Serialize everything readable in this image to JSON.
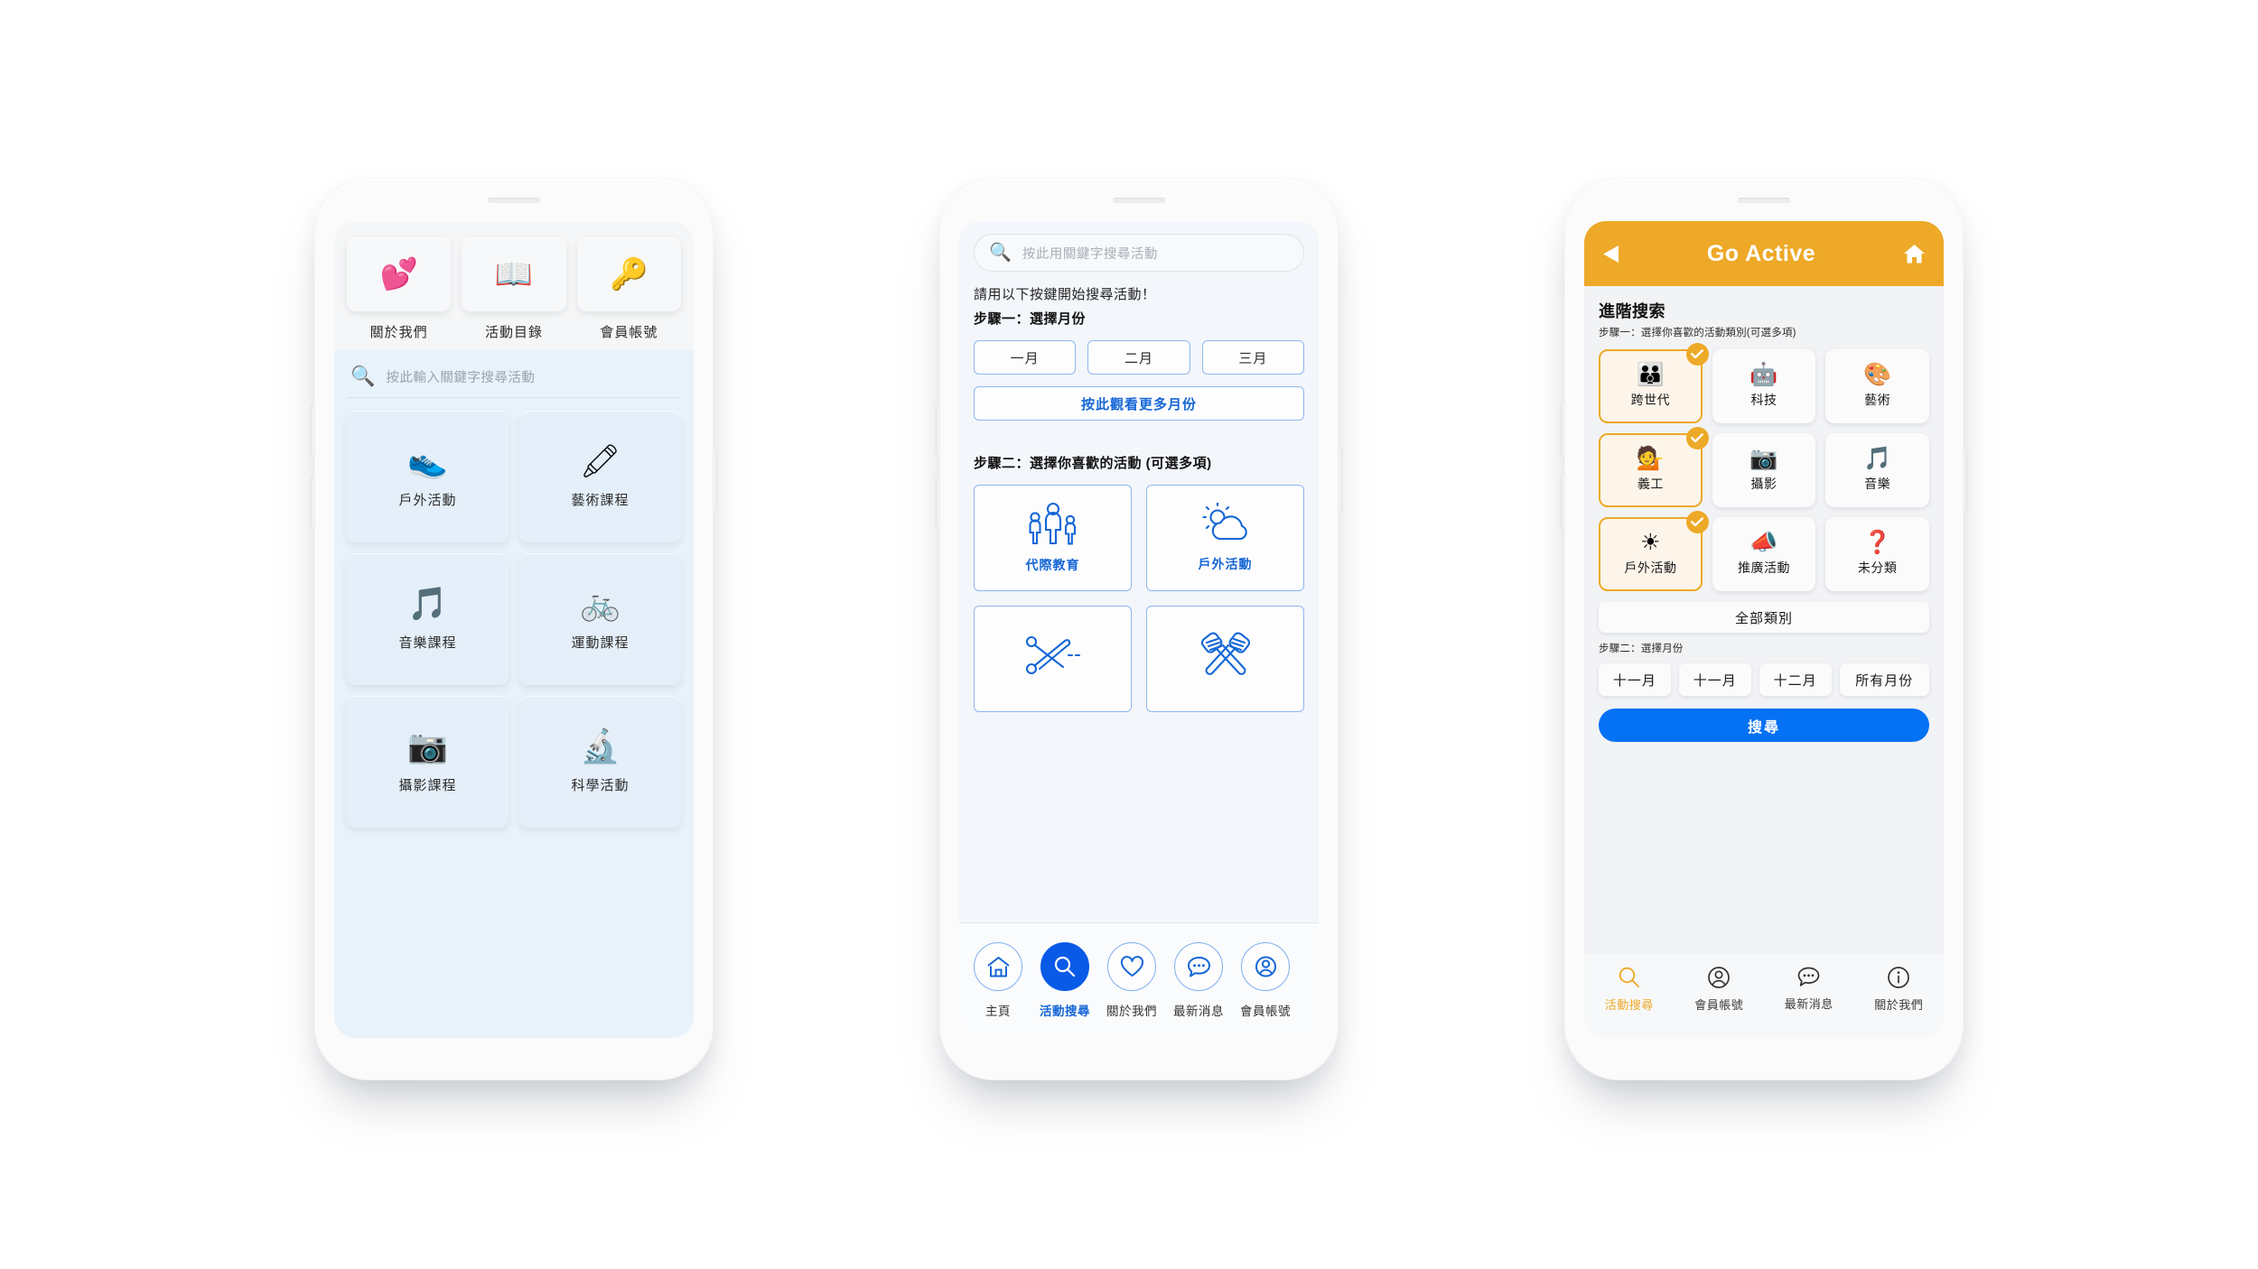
{
  "phone1": {
    "top_tiles": [
      {
        "icon": "two-hearts-emoji",
        "glyph": "💕",
        "label": "關於我們"
      },
      {
        "icon": "open-book-emoji",
        "glyph": "📖",
        "label": "活動目錄"
      },
      {
        "icon": "key-emoji",
        "glyph": "🔑",
        "label": "會員帳號"
      }
    ],
    "search": {
      "placeholder": "按此輸入關鍵字搜尋活動",
      "icon": "magnifier-icon"
    },
    "cards": [
      {
        "icon": "running-shoe-emoji",
        "glyph": "👟",
        "label": "戶外活動"
      },
      {
        "icon": "crayon-emoji",
        "glyph": "🖍",
        "label": "藝術課程"
      },
      {
        "icon": "music-note-emoji",
        "glyph": "🎵",
        "label": "音樂課程"
      },
      {
        "icon": "bicycle-emoji",
        "glyph": "🚲",
        "label": "運動課程"
      },
      {
        "icon": "camera-emoji",
        "glyph": "📷",
        "label": "攝影課程"
      },
      {
        "icon": "microscope-emoji",
        "glyph": "🔬",
        "label": "科學活動"
      }
    ]
  },
  "phone2": {
    "search": {
      "placeholder": "按此用關鍵字搜尋活動",
      "icon": "magnifier-icon"
    },
    "intro": "請用以下按鍵開始搜尋活動！",
    "step1_label": "步驟一：選擇月份",
    "months": [
      "一月",
      "二月",
      "三月"
    ],
    "more_months_label": "按此觀看更多月份",
    "step2_label": "步驟二：選擇你喜歡的活動 (可選多項)",
    "activity_cards": [
      {
        "icon": "three-people-icon",
        "label": "代際教育"
      },
      {
        "icon": "sun-cloud-icon",
        "label": "戶外活動"
      },
      {
        "icon": "scissors-comb-icon",
        "label": ""
      },
      {
        "icon": "crossed-spatulas-icon",
        "label": ""
      }
    ],
    "nav": [
      {
        "icon": "home-icon",
        "label": "主頁",
        "active": false
      },
      {
        "icon": "search-icon",
        "label": "活動搜尋",
        "active": true
      },
      {
        "icon": "heart-icon",
        "label": "關於我們",
        "active": false
      },
      {
        "icon": "chat-bubble-icon",
        "label": "最新消息",
        "active": false
      },
      {
        "icon": "user-circle-icon",
        "label": "會員帳號",
        "active": false
      }
    ]
  },
  "phone3": {
    "header": {
      "title": "Go Active",
      "back_icon": "back-triangle-icon",
      "home_icon": "home-icon"
    },
    "heading": "進階搜索",
    "step1_label": "步驟一：選擇你喜歡的活動類別(可選多項)",
    "categories": [
      {
        "icon": "family-emoji",
        "glyph": "👪",
        "label": "跨世代",
        "selected": true
      },
      {
        "icon": "robot-emoji",
        "glyph": "🤖",
        "label": "科技",
        "selected": false
      },
      {
        "icon": "artist-palette-emoji",
        "glyph": "🎨",
        "label": "藝術",
        "selected": false
      },
      {
        "icon": "information-person-emoji",
        "glyph": "💁",
        "label": "義工",
        "selected": true
      },
      {
        "icon": "camera-emoji",
        "glyph": "📷",
        "label": "攝影",
        "selected": false
      },
      {
        "icon": "music-note-emoji",
        "glyph": "🎵",
        "label": "音樂",
        "selected": false
      },
      {
        "icon": "sun-emoji",
        "glyph": "☀",
        "label": "戶外活動",
        "selected": true
      },
      {
        "icon": "megaphone-emoji",
        "glyph": "📣",
        "label": "推廣活動",
        "selected": false
      },
      {
        "icon": "question-mark-emoji",
        "glyph": "❓",
        "label": "未分類",
        "selected": false
      }
    ],
    "all_categories_label": "全部類別",
    "step2_label": "步驟二：選擇月份",
    "months": [
      "十一月",
      "十一月",
      "十二月",
      "所有月份"
    ],
    "search_button_label": "搜尋",
    "nav": [
      {
        "icon": "search-icon",
        "label": "活動搜尋",
        "active": true
      },
      {
        "icon": "user-circle-icon",
        "label": "會員帳號",
        "active": false
      },
      {
        "icon": "chat-bubble-icon",
        "label": "最新消息",
        "active": false
      },
      {
        "icon": "info-circle-icon",
        "label": "關於我們",
        "active": false
      }
    ]
  },
  "colors": {
    "brand_orange": "#EDA927",
    "brand_blue": "#0571F5",
    "nav_blue": "#0A5AE8",
    "light_blue_bg": "#E8F2FA"
  }
}
